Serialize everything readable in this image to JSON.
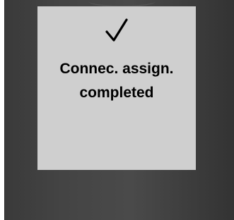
{
  "dialog": {
    "icon": "checkmark-icon",
    "message_line1": "Connec. assign.",
    "message_line2": "completed"
  },
  "colors": {
    "device_body": "#444444",
    "screen_background": "#cfcfcf",
    "text": "#000000"
  }
}
